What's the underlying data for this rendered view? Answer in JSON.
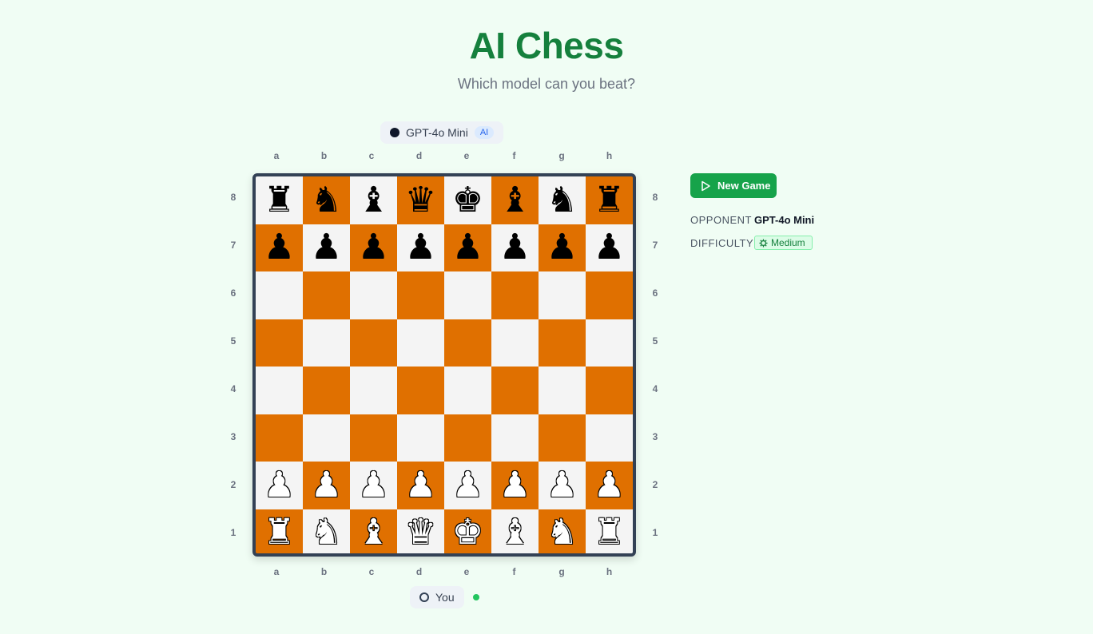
{
  "header": {
    "title": "AI Chess",
    "subtitle": "Which model can you beat?"
  },
  "opponent_pill": {
    "name": "GPT-4o Mini",
    "badge": "AI"
  },
  "player_pill": {
    "name": "You"
  },
  "board": {
    "files": [
      "a",
      "b",
      "c",
      "d",
      "e",
      "f",
      "g",
      "h"
    ],
    "ranks": [
      "8",
      "7",
      "6",
      "5",
      "4",
      "3",
      "2",
      "1"
    ],
    "light_color": "#f4f4f4",
    "dark_color": "#e07000",
    "position": [
      [
        "r",
        "n",
        "b",
        "q",
        "k",
        "b",
        "n",
        "r"
      ],
      [
        "p",
        "p",
        "p",
        "p",
        "p",
        "p",
        "p",
        "p"
      ],
      [
        "",
        "",
        "",
        "",
        "",
        "",
        "",
        ""
      ],
      [
        "",
        "",
        "",
        "",
        "",
        "",
        "",
        ""
      ],
      [
        "",
        "",
        "",
        "",
        "",
        "",
        "",
        ""
      ],
      [
        "",
        "",
        "",
        "",
        "",
        "",
        "",
        ""
      ],
      [
        "P",
        "P",
        "P",
        "P",
        "P",
        "P",
        "P",
        "P"
      ],
      [
        "R",
        "N",
        "B",
        "Q",
        "K",
        "B",
        "N",
        "R"
      ]
    ]
  },
  "sidebar": {
    "new_game_label": "New Game",
    "opponent_label": "OPPONENT",
    "opponent_value": "GPT-4o Mini",
    "difficulty_label": "DIFFICULTY",
    "difficulty_value": "Medium"
  },
  "colors": {
    "accent": "#16a34a",
    "title": "#15803d",
    "turn_indicator": "#22c55e"
  }
}
